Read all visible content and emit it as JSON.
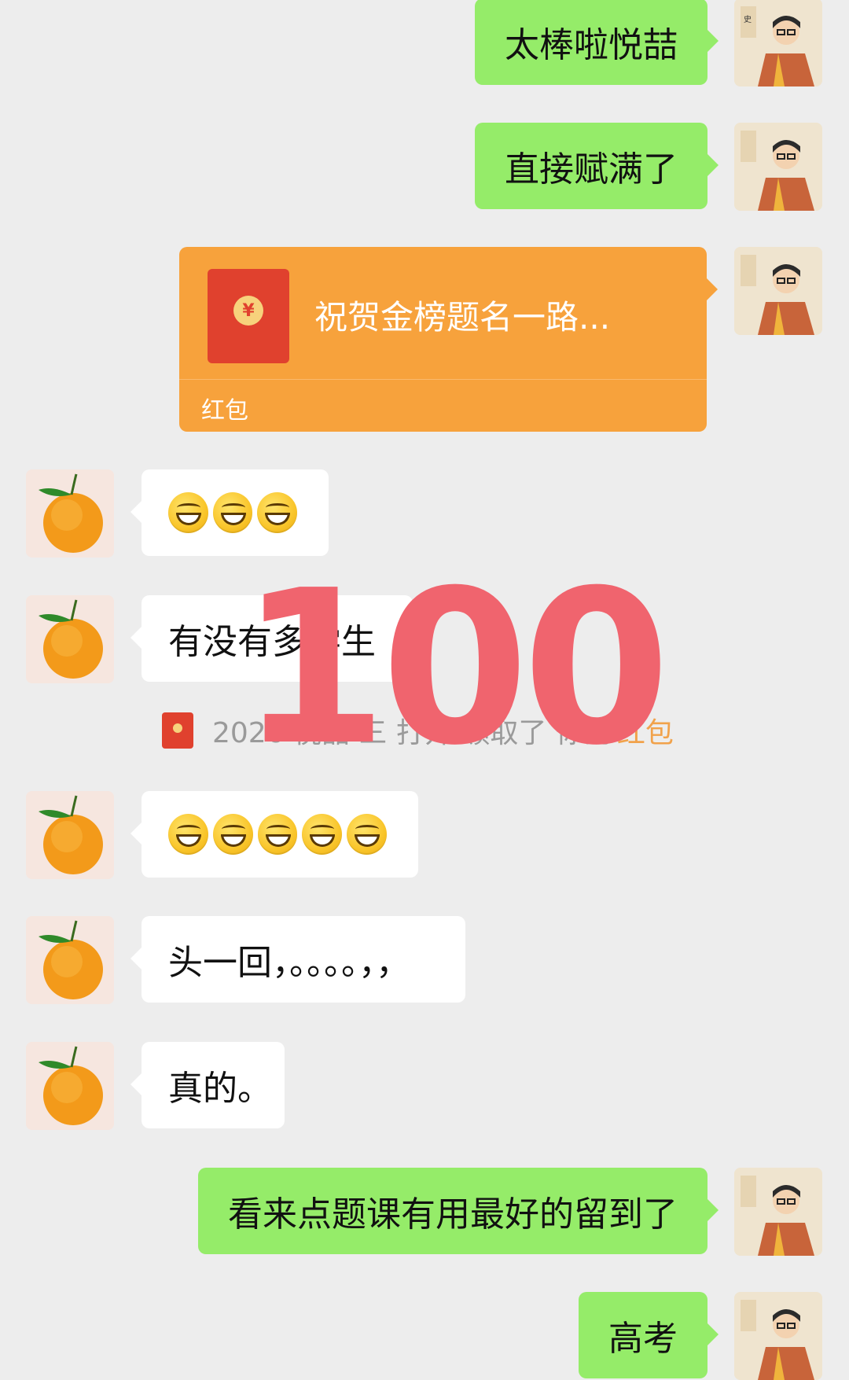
{
  "messages": {
    "m1": "太棒啦悦喆",
    "m2": "直接赋满了",
    "red_packet": {
      "title": "祝贺金榜题名一路...",
      "label": "红包",
      "currency": "¥"
    },
    "m4_emoji_count": 3,
    "m5": "有没有多学生",
    "notice": {
      "text": "2026 悦喆 三 打开 领取了 你的",
      "link": "红包"
    },
    "m6_emoji_count": 5,
    "m7": "头一回，。。。。，，",
    "m8": "真的。",
    "m9": "看来点题课有用最好的留到了",
    "m10": "高考"
  },
  "stamp": {
    "text": "100",
    "color": "#f0646e"
  },
  "colors": {
    "sent_bubble": "#95ec69",
    "received_bubble": "#ffffff",
    "red_packet": "#f7a23c",
    "background": "#ededed"
  },
  "icons": {
    "teacher_avatar": "cartoon-teacher-avatar",
    "student_avatar": "orange-fruit-avatar",
    "emoji": "grinning-face-emoji"
  }
}
